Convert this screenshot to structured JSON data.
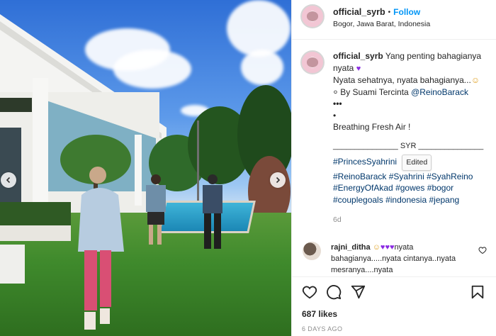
{
  "post": {
    "username": "official_syrb",
    "follow_label": "Follow",
    "separator": "•",
    "location": "Bogor, Jawa Barat, Indonesia"
  },
  "caption": {
    "username": "official_syrb",
    "line1": "Yang penting bahagianya nyata",
    "line2": "Nyata sehatnya, nyata bahagianya...",
    "by_prefix": "By Suami Tercinta",
    "mention": "@ReinoBarack",
    "dots1": "•••",
    "dots2": "•",
    "line3": "Breathing Fresh Air !",
    "signature": "_______________ SYR _______________",
    "edited_label": "Edited",
    "hashtags": [
      "#PrincesSyahrini",
      "#ReinoBarack",
      "#Syahrini",
      "#SyahReino",
      "#EnergyOfAkad",
      "#gowes",
      "#bogor",
      "#couplegoals",
      "#indonesia",
      "#jepang"
    ],
    "age": "6d"
  },
  "comment": {
    "username": "rajni_ditha",
    "text": "nyata bahagianya.....nyata cintanya..nyata mesranya....nyata"
  },
  "actions": {
    "likes": "687 likes",
    "timestamp": "6 DAYS AGO"
  },
  "icons": {
    "prev": "chevron-left-icon",
    "next": "chevron-right-icon",
    "like": "heart-icon",
    "comment": "comment-icon",
    "share": "paper-plane-icon",
    "save": "bookmark-icon"
  },
  "colors": {
    "follow": "#0095f6",
    "link": "#00376b",
    "muted": "#8e8e8e",
    "heart_purple": "#8a2be2"
  }
}
